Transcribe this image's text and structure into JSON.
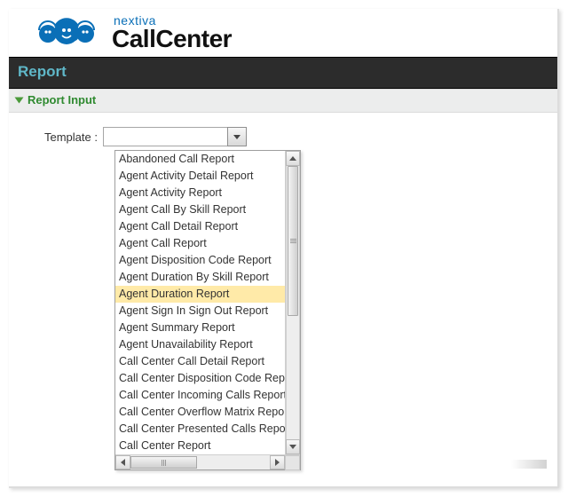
{
  "brand": {
    "small": "nextiva",
    "big": "CallCenter"
  },
  "title_bar": "Report",
  "section": {
    "label": "Report Input"
  },
  "form": {
    "template_label": "Template :",
    "template_value": ""
  },
  "dropdown": {
    "highlighted_index": 8,
    "options": [
      "Abandoned Call Report",
      "Agent Activity Detail Report",
      "Agent Activity Report",
      "Agent Call By Skill Report",
      "Agent Call Detail Report",
      "Agent Call Report",
      "Agent Disposition Code Report",
      "Agent Duration By Skill Report",
      "Agent Duration Report",
      "Agent Sign In Sign Out Report",
      "Agent Summary Report",
      "Agent Unavailability Report",
      "Call Center Call Detail Report",
      "Call Center Disposition Code Report",
      "Call Center Incoming Calls Report",
      "Call Center Overflow Matrix Report",
      "Call Center Presented Calls Report",
      "Call Center Report"
    ]
  }
}
